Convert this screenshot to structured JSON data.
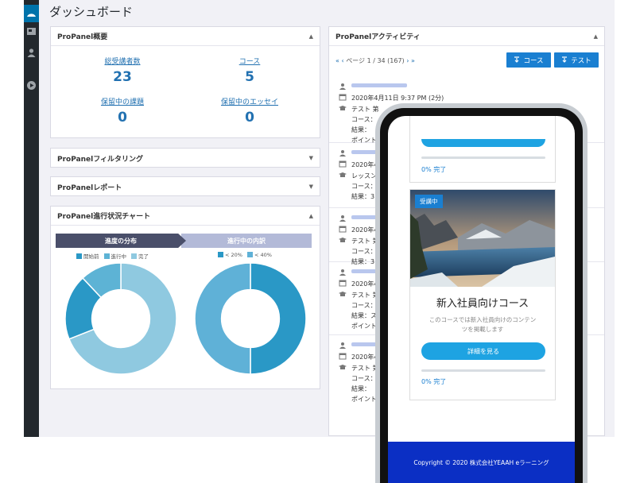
{
  "page_title": "ダッシュボード",
  "overview": {
    "title": "ProPanel概要",
    "stats": [
      {
        "label": "総受講者数",
        "value": "23"
      },
      {
        "label": "コース",
        "value": "5"
      },
      {
        "label": "保留中の課題",
        "value": "0"
      },
      {
        "label": "保留中のエッセイ",
        "value": "0"
      }
    ]
  },
  "filtering": {
    "title": "ProPanelフィルタリング"
  },
  "reports": {
    "title": "ProPanelレポート"
  },
  "progress_chart": {
    "title": "ProPanel進行状況チャート",
    "left_header": "進度の分布",
    "right_header": "進行中の内訳",
    "left_legend": [
      "開始前",
      "進行中",
      "完了"
    ],
    "right_legend": [
      "< 20%",
      "< 40%"
    ]
  },
  "chart_data": [
    {
      "type": "pie",
      "title": "進度の分布",
      "categories": [
        "完了",
        "開始前",
        "進行中"
      ],
      "values": [
        69,
        19,
        12
      ],
      "colors": [
        "#8fc9e0",
        "#2a98c6",
        "#5db3d5"
      ]
    },
    {
      "type": "pie",
      "title": "進行中の内訳",
      "categories": [
        "< 20%",
        "< 40%"
      ],
      "values": [
        50,
        50
      ],
      "colors": [
        "#2a98c6",
        "#5fb1d7"
      ]
    }
  ],
  "activity": {
    "title": "ProPanelアクティビティ",
    "pagination": {
      "prev": "« ‹",
      "text": "ページ 1 / 34 (167)",
      "next": "› »"
    },
    "btn_course": "コース",
    "btn_test": "テスト",
    "items": [
      {
        "date": "2020年4月11日 9:37 PM (2分)",
        "type": "テスト 第",
        "course": "コース：",
        "result": "結果：",
        "point": "ポイント"
      },
      {
        "date": "2020年4",
        "type": "レッスン",
        "course": "コース：",
        "result": "結果：3"
      },
      {
        "date": "2020年4",
        "type": "テスト 第",
        "course": "コース：",
        "result": "結果：3"
      },
      {
        "date": "2020年4",
        "type": "テスト 第",
        "course": "コース：",
        "result": "結果：ス",
        "point": "ポイント"
      },
      {
        "date": "2020年4",
        "type": "テスト 第",
        "course": "コース：",
        "result": "結果：",
        "point": "ポイント"
      }
    ]
  },
  "phone": {
    "progress_top": "0% 完了",
    "badge": "受講中",
    "course_title": "新入社員向けコース",
    "course_desc_line1": "このコースでは新入社員向けのコンテン",
    "course_desc_line2": "ツを掲載します",
    "detail_button": "詳細を見る",
    "progress_bottom": "0% 完了",
    "footer": "Copyright © 2020 株式会社YEAAH eラーニング"
  },
  "colors": {
    "accent": "#1a7fd1",
    "footer": "#0b2fc4",
    "sidebar": "#23282d"
  }
}
